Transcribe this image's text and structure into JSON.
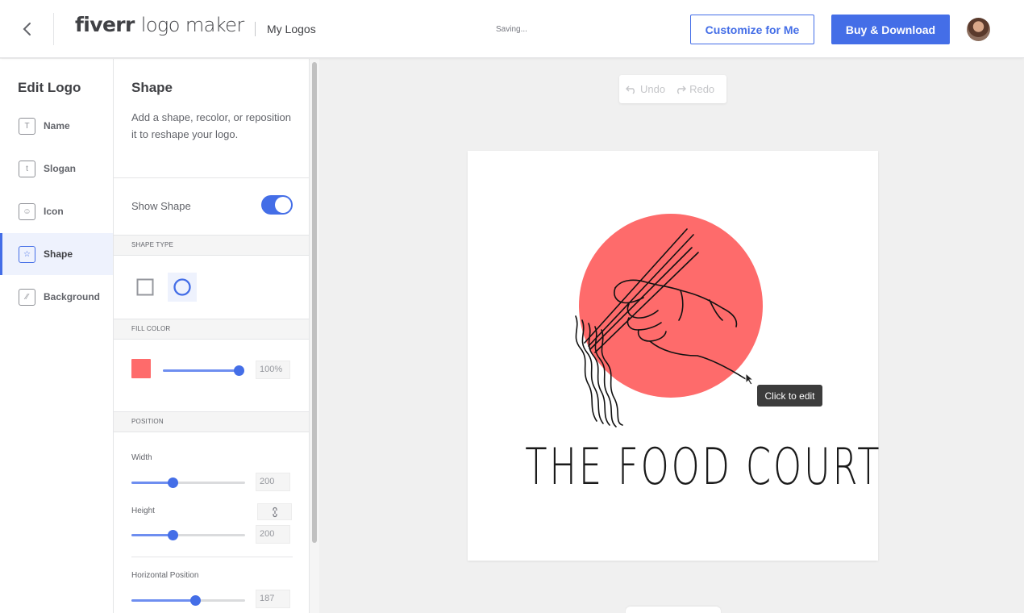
{
  "header": {
    "brand_bold": "fiverr",
    "brand_rest": "logo maker",
    "my_logos": "My Logos",
    "status": "Saving...",
    "customize_label": "Customize for Me",
    "buy_label": "Buy & Download"
  },
  "sidebar": {
    "title": "Edit Logo",
    "items": [
      {
        "label": "Name",
        "icon": "text-icon",
        "glyph": "T"
      },
      {
        "label": "Slogan",
        "icon": "slogan-icon",
        "glyph": "t"
      },
      {
        "label": "Icon",
        "icon": "image-icon",
        "glyph": "☺"
      },
      {
        "label": "Shape",
        "icon": "star-icon",
        "glyph": "☆"
      },
      {
        "label": "Background",
        "icon": "pattern-icon",
        "glyph": "⁄⁄"
      }
    ],
    "active": "Shape"
  },
  "panel": {
    "title": "Shape",
    "description": "Add a shape, recolor, or reposition it to reshape your logo.",
    "show_shape_label": "Show Shape",
    "show_shape_on": true,
    "shape_type_header": "SHAPE TYPE",
    "shape_types": [
      "square",
      "circle"
    ],
    "selected_shape": "circle",
    "fill_color_header": "FILL COLOR",
    "fill_color": "#fe6b6b",
    "opacity": {
      "value": "100%",
      "fraction": 0.98
    },
    "position_header": "POSITION",
    "width": {
      "label": "Width",
      "value": "200",
      "fraction": 0.36
    },
    "height": {
      "label": "Height",
      "value": "200",
      "fraction": 0.36
    },
    "horizontal": {
      "label": "Horizontal Position",
      "value": "187",
      "fraction": 0.56
    }
  },
  "canvas": {
    "undo_label": "Undo",
    "redo_label": "Redo",
    "logo_text": "THE FOOD COURT",
    "tooltip": "Click to edit",
    "accent_color": "#446ee7"
  }
}
